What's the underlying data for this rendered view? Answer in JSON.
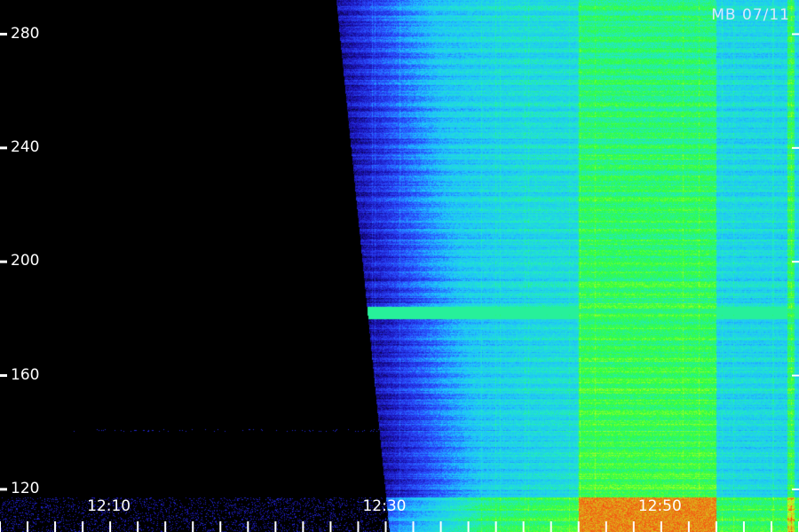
{
  "corner_label": "MB 07/11",
  "chart_data": {
    "type": "heatmap",
    "title": "",
    "xlabel": "",
    "ylabel": "",
    "y_ticks": [
      280,
      240,
      200,
      160,
      120
    ],
    "ylim": [
      105,
      292
    ],
    "x_ticks": [
      "12:10",
      "12:30",
      "12:50"
    ],
    "xlim_minutes": [
      "12:02",
      "13:00"
    ],
    "colormap": [
      "#000000",
      "#1a0fb0",
      "#2a4bff",
      "#1fc2ff",
      "#22e8c8",
      "#30ff40",
      "#c8ff20",
      "#ff3010"
    ],
    "features": {
      "onset_time": "12:28",
      "horizontal_band_value": 182,
      "bright_block_start": "12:44",
      "bright_block_end": "12:54"
    }
  }
}
